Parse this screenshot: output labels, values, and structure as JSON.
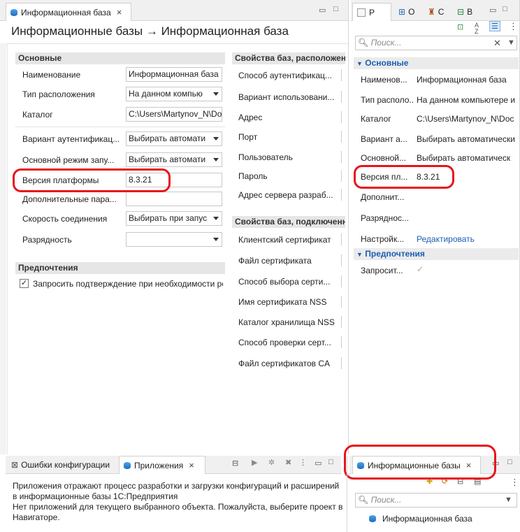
{
  "editor": {
    "tab_label": "Информационная база",
    "page_title": "Информационные базы → Информационная база",
    "main": {
      "section_title": "Основные",
      "rows": [
        {
          "label": "Наименование",
          "value": "Информационная база",
          "kind": "text"
        },
        {
          "label": "Тип расположения",
          "value": "На данном компью",
          "kind": "combo"
        },
        {
          "label": "Каталог",
          "value": "C:\\Users\\Martynov_N\\Doc",
          "kind": "text"
        },
        {
          "label": "Вариант аутентификац...",
          "value": "Выбирать автомати",
          "kind": "combo"
        },
        {
          "label": "Основной режим запу...",
          "value": "Выбирать автомати",
          "kind": "combo"
        },
        {
          "label": "Версия платформы",
          "value": "8.3.21",
          "kind": "text"
        },
        {
          "label": "Дополнительные пара...",
          "value": "",
          "kind": "text"
        },
        {
          "label": "Скорость соединения",
          "value": "Выбирать при запус",
          "kind": "combo"
        },
        {
          "label": "Разрядность",
          "value": "",
          "kind": "combo"
        }
      ],
      "prefs_title": "Предпочтения",
      "prefs_check_label": "Запросить подтверждение при необходимости ре"
    },
    "right_col": {
      "section1_title": "Свойства баз, расположенн",
      "section1_rows": [
        "Способ аутентификац...",
        "Вариант использовани...",
        "Адрес",
        "Порт",
        "Пользователь",
        "Пароль",
        "Адрес сервера разраб..."
      ],
      "section2_title": "Свойства баз, подключенн",
      "section2_rows": [
        "Клиентский сертификат",
        "Файл сертификата",
        "Способ выбора серти...",
        "Имя сертификата NSS",
        "Каталог хранилища NSS",
        "Способ проверки серт...",
        "Файл сертификатов CA"
      ]
    }
  },
  "props": {
    "tabs": [
      "Р",
      "О",
      "С",
      "В"
    ],
    "search_placeholder": "Поиск...",
    "section1_title": "Основные",
    "rows": [
      {
        "label": "Наименов...",
        "value": "Информационная база"
      },
      {
        "label": "Тип располо...",
        "value": "На данном компьютере и"
      },
      {
        "label": "Каталог",
        "value": "C:\\Users\\Martynov_N\\Doc"
      },
      {
        "label": "Вариант а...",
        "value": "Выбирать автоматически"
      },
      {
        "label": "Основной...",
        "value": "Выбирать автоматическ"
      },
      {
        "label": "Версия пл...",
        "value": "8.3.21"
      },
      {
        "label": "Дополнит...",
        "value": ""
      },
      {
        "label": "Разряднос...",
        "value": ""
      },
      {
        "label": "Настройк...",
        "value": "Редактировать"
      }
    ],
    "section2_title": "Предпочтения",
    "prefs_row_label": "Запросит..."
  },
  "bottom": {
    "tab_errors": "Ошибки конфигурации",
    "tab_apps": "Приложения",
    "apps_text_lines": [
      "Приложения отражают процесс разработки и загрузки конфигураций и расширений",
      "в информационные базы 1С:Предприятия",
      "Нет приложений для текущего выбранного объекта. Пожалуйста, выберите проект в",
      "Навигаторе."
    ],
    "infobases_tab": "Информационные базы",
    "infobases_search_placeholder": "Поиск...",
    "infobase_item": "Информационная база"
  },
  "colors": {
    "highlight_red": "#e8141c",
    "section_blue": "#1a5fb4"
  }
}
